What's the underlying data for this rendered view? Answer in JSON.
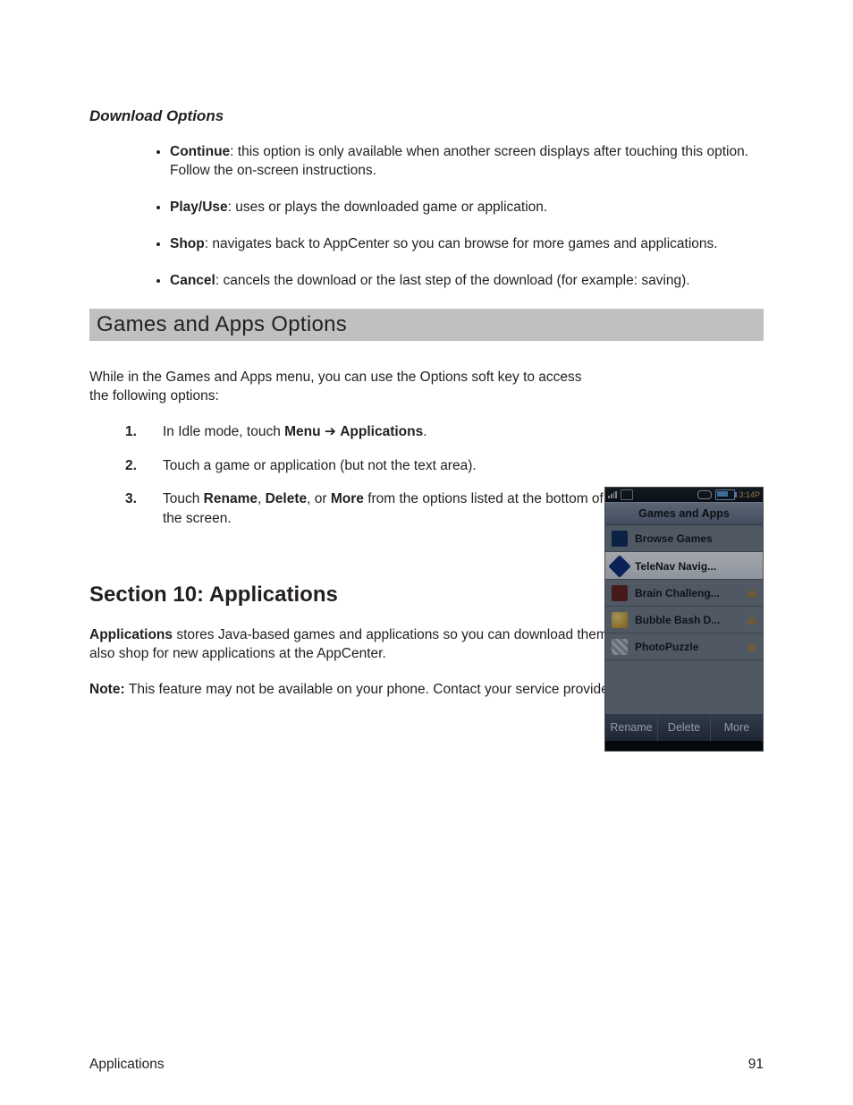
{
  "subsection_title": "Download Options",
  "bullets": [
    {
      "lead": "Continue",
      "rest": ": this option is only available when another screen displays after touching this option. Follow the on-screen instructions."
    },
    {
      "lead": "Play/Use",
      "rest": ": uses or plays the downloaded game or application."
    },
    {
      "lead": "Shop",
      "rest": ": navigates back to AppCenter so you can browse for more games and applications."
    },
    {
      "lead": "Cancel",
      "rest": ": cancels the download or the last step of the download (for example: saving)."
    }
  ],
  "banner": "Games and Apps Options",
  "intro": "While in the Games and Apps menu, you can use the Options soft key to access the following options:",
  "steps": [
    {
      "num": "1.",
      "pre": "In Idle mode, touch ",
      "bold1": "Menu",
      "sep": " ➔ ",
      "bold2": "Applications",
      "post": "."
    },
    {
      "num": "2.",
      "text": "Touch a game or application (but not the text area)."
    },
    {
      "num": "3.",
      "pre": "Touch ",
      "bold1": "Rename",
      "mid1": ", ",
      "bold2": "Delete",
      "mid2": ", or ",
      "bold3": "More",
      "post": " from the options listed at the bottom of the screen."
    }
  ],
  "phone": {
    "time": "3:14P",
    "title": "Games and Apps",
    "items": [
      {
        "label": "Browse Games",
        "locked": false,
        "selected": false
      },
      {
        "label": "TeleNav Navig...",
        "locked": false,
        "selected": true
      },
      {
        "label": "Brain Challeng...",
        "locked": true,
        "selected": false
      },
      {
        "label": "Bubble Bash D...",
        "locked": true,
        "selected": false
      },
      {
        "label": "PhotoPuzzle",
        "locked": true,
        "selected": false
      }
    ],
    "soft": [
      "Rename",
      "Delete",
      "More"
    ]
  },
  "sec10": {
    "heading": "Section 10: Applications",
    "para_bold": "Applications",
    "para_rest": " stores Java-based games and applications so you can download them to your phone. You can also shop for new applications at the AppCenter.",
    "note_lead": "Note: ",
    "note_rest": "This feature may not be available on your phone. Contact your service provider for more details."
  },
  "footer": {
    "left": "Applications",
    "right": "91"
  }
}
